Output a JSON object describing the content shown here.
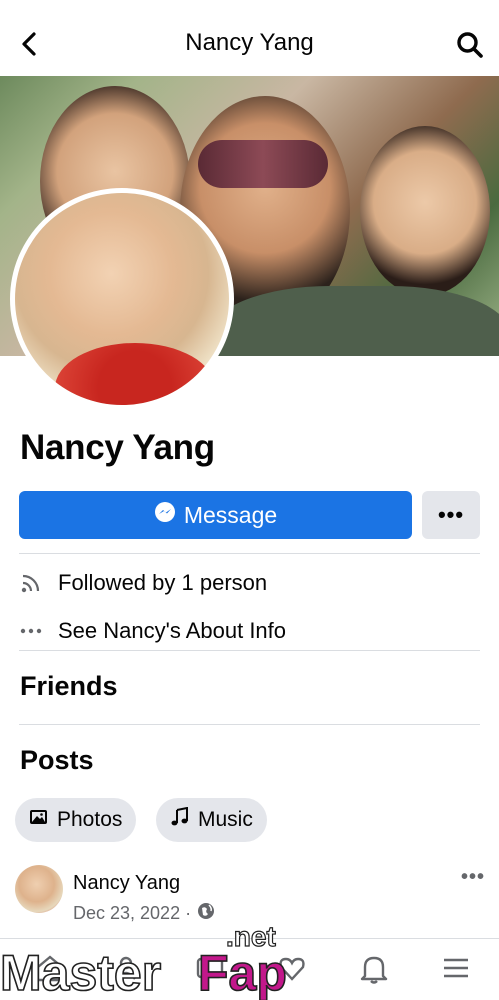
{
  "header": {
    "title": "Nancy Yang",
    "back_icon": "chevron-left-icon",
    "search_icon": "search-icon"
  },
  "profile": {
    "name": "Nancy Yang",
    "message_label": "Message",
    "more_label": "•••"
  },
  "info": {
    "followed_by": "Followed by 1 person",
    "about": "See Nancy's About Info"
  },
  "sections": {
    "friends": "Friends",
    "posts": "Posts"
  },
  "chips": {
    "photos": "Photos",
    "music": "Music"
  },
  "post": {
    "author": "Nancy Yang",
    "date": "Dec 23, 2022 ·",
    "more": "•••"
  },
  "watermark": {
    "brand": "MasterFap",
    "tld": ".net"
  },
  "colors": {
    "accent": "#1b74e4",
    "secondary_button": "#e4e6eb",
    "muted_text": "#65676b"
  }
}
